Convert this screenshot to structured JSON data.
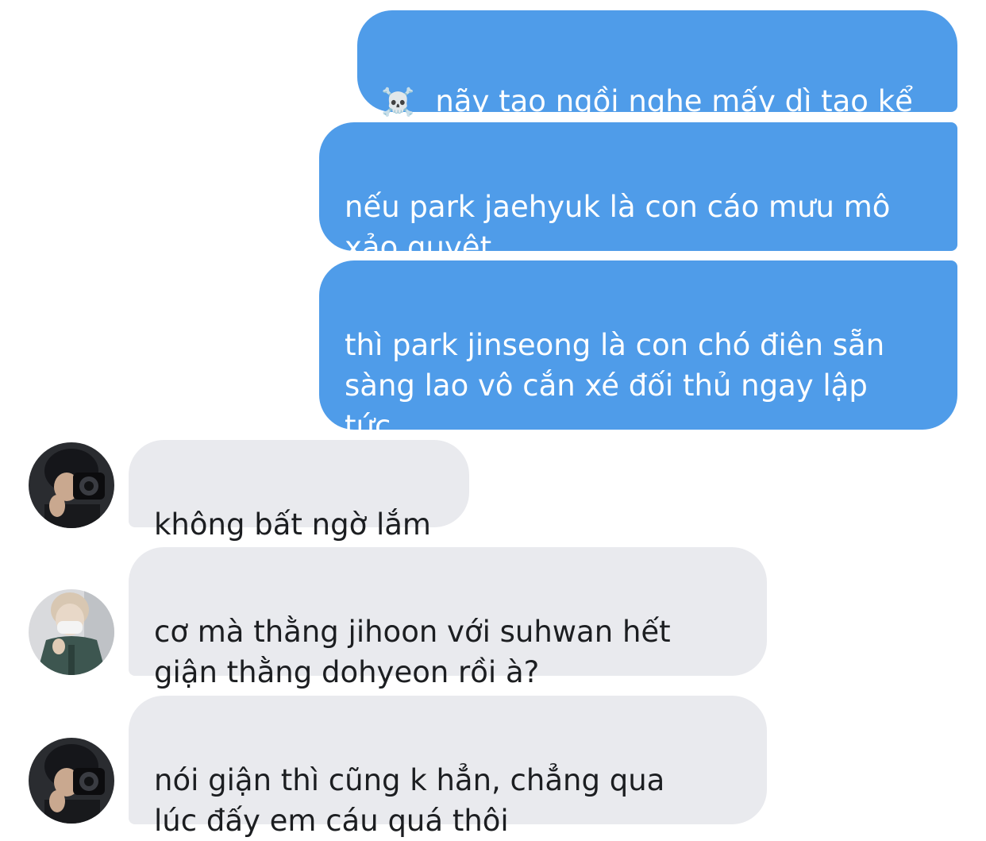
{
  "messages": [
    {
      "id": "m1",
      "direction": "outgoing",
      "emoji": "☠️",
      "text": "nãy tao ngồi nghe mấy dì tao kể"
    },
    {
      "id": "m2",
      "direction": "outgoing",
      "text": "nếu park jaehyuk là con cáo mưu mô\nxảo quyệt"
    },
    {
      "id": "m3",
      "direction": "outgoing",
      "text": "thì park jinseong là con chó điên sẵn\nsàng lao vô cắn xé đối thủ ngay lập\ntức"
    },
    {
      "id": "m4",
      "direction": "incoming",
      "avatar": "avatar-camera",
      "text": "không bất ngờ lắm"
    },
    {
      "id": "m5",
      "direction": "incoming",
      "avatar": "avatar-mask",
      "text": "cơ mà thằng jihoon với suhwan hết\ngiận thằng dohyeon rồi à?"
    },
    {
      "id": "m6",
      "direction": "incoming",
      "avatar": "avatar-camera",
      "text": "nói giận thì cũng k hẳn, chẳng qua\nlúc đấy em cáu quá thôi"
    }
  ],
  "colors": {
    "outgoing_bubble": "#4f9ce9",
    "incoming_bubble": "#e9eaee",
    "outgoing_text": "#ffffff",
    "incoming_text": "#1c1e21"
  }
}
